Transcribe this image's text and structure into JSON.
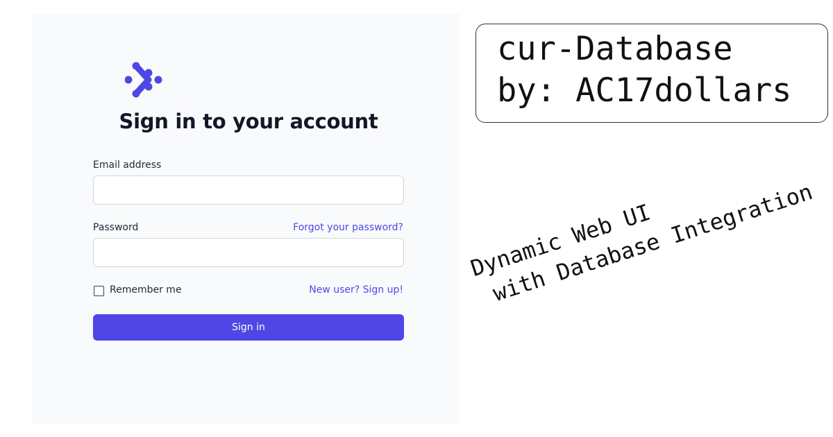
{
  "login": {
    "title": "Sign in to your account",
    "email_label": "Email address",
    "email_value": "",
    "password_label": "Password",
    "password_value": "",
    "forgot_link": "Forgot your password?",
    "remember_label": "Remember me",
    "remember_checked": false,
    "signup_link": "New user? Sign up!",
    "signin_button": "Sign in",
    "logo_icon": "dots-arrow-logo-icon"
  },
  "note": {
    "line1": "cur-Database",
    "line2": "by: AC17dollars"
  },
  "caption": {
    "line1": "Dynamic Web UI",
    "line2": " with Database Integration"
  },
  "colors": {
    "accent": "#4f46e5",
    "panel_background": "#f9fafb",
    "title_text": "#111827"
  }
}
